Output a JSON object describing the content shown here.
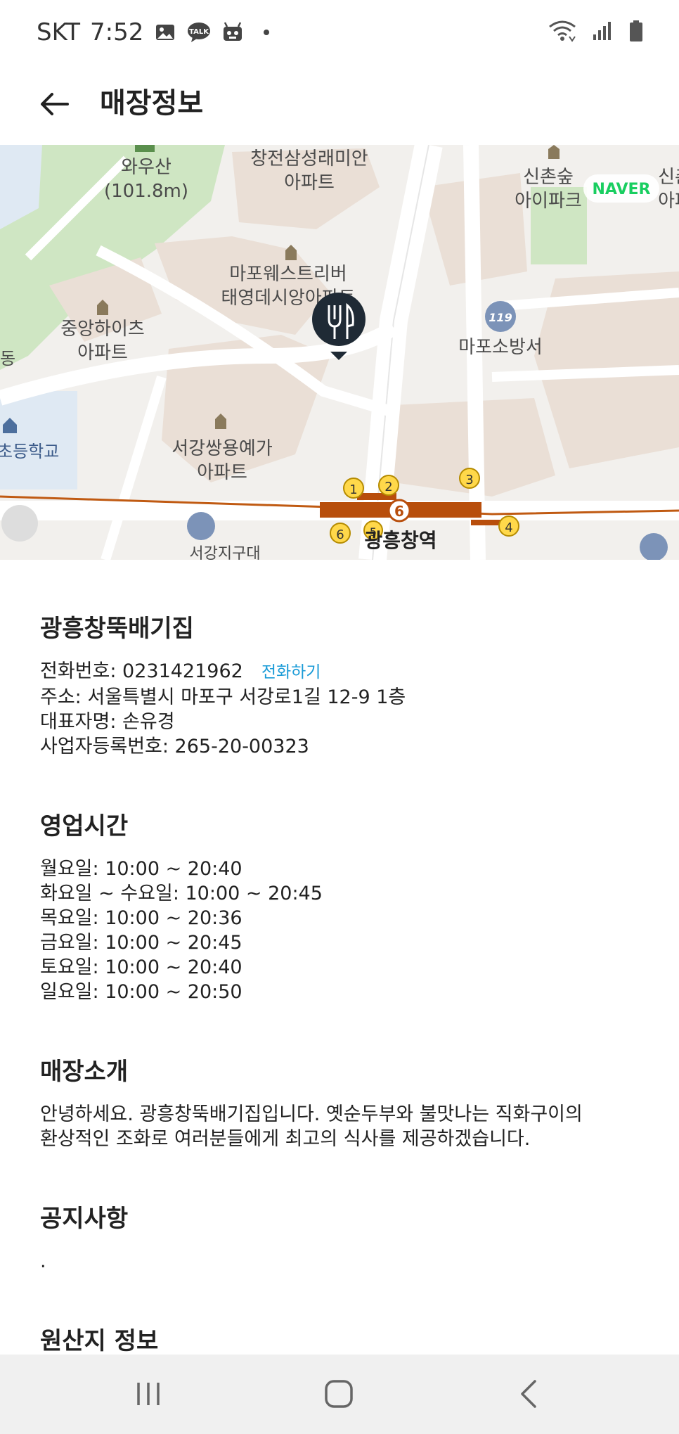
{
  "status_bar": {
    "carrier": "SKT",
    "time": "7:52",
    "talk_badge": "TALK"
  },
  "header": {
    "title": "매장정보"
  },
  "map": {
    "brand": "NAVER",
    "labels": {
      "waw": "와우산",
      "waw_height": "(101.8m)",
      "changjeon1": "창전삼성래미안",
      "changjeon2": "아파트",
      "sinchon1": "신촌숲",
      "sinchon2": "아이파크",
      "sinchon_edge1": "신촌",
      "sinchon_edge2": "아파",
      "mapo_west1": "마포웨스트리버",
      "mapo_west2": "태영데시앙아파트",
      "jungang1": "중앙하이츠",
      "jungang2": "아파트",
      "fire": "마포소방서",
      "fire_badge": "119",
      "school": "초등학교",
      "seogang1": "서강쌍용예가",
      "seogang2": "아파트",
      "station": "광흥창역",
      "seogang_district": "서강지구대",
      "left_edge": "동",
      "line_num": "6",
      "exit1": "1",
      "exit2": "2",
      "exit3": "3",
      "exit4": "4",
      "exit5": "5",
      "exit6": "6"
    }
  },
  "store": {
    "name": "광흥창뚝배기집",
    "phone": "전화번호: 0231421962",
    "call_label": "전화하기",
    "address": "주소: 서울특별시 마포구 서강로1길 12-9 1층",
    "owner": "대표자명: 손유경",
    "biz_no": "사업자등록번호: 265-20-00323"
  },
  "hours": {
    "title": "영업시간",
    "rows": [
      "월요일: 10:00 ~ 20:40",
      "화요일 ~ 수요일: 10:00 ~ 20:45",
      "목요일: 10:00 ~ 20:36",
      "금요일: 10:00 ~ 20:45",
      "토요일: 10:00 ~ 20:40",
      "일요일: 10:00 ~ 20:50"
    ]
  },
  "intro": {
    "title": "매장소개",
    "line1": "안녕하세요. 광흥창뚝배기집입니다. 옛순두부와 불맛나는 직화구이의",
    "line2": "환상적인 조화로 여러분들에게 최고의 식사를 제공하겠습니다."
  },
  "notice": {
    "title": "공지사항",
    "body": "."
  },
  "origin": {
    "title": "원산지 정보"
  },
  "icons": {
    "status": [
      "gallery-icon",
      "kakaotalk-icon",
      "android-icon",
      "dot-icon",
      "wifi-icon",
      "signal-icon",
      "battery-icon"
    ],
    "back": "arrow-left-icon",
    "marker": "fork-knife-icon",
    "nav": [
      "recent-apps-icon",
      "home-icon",
      "back-chevron-icon"
    ]
  }
}
